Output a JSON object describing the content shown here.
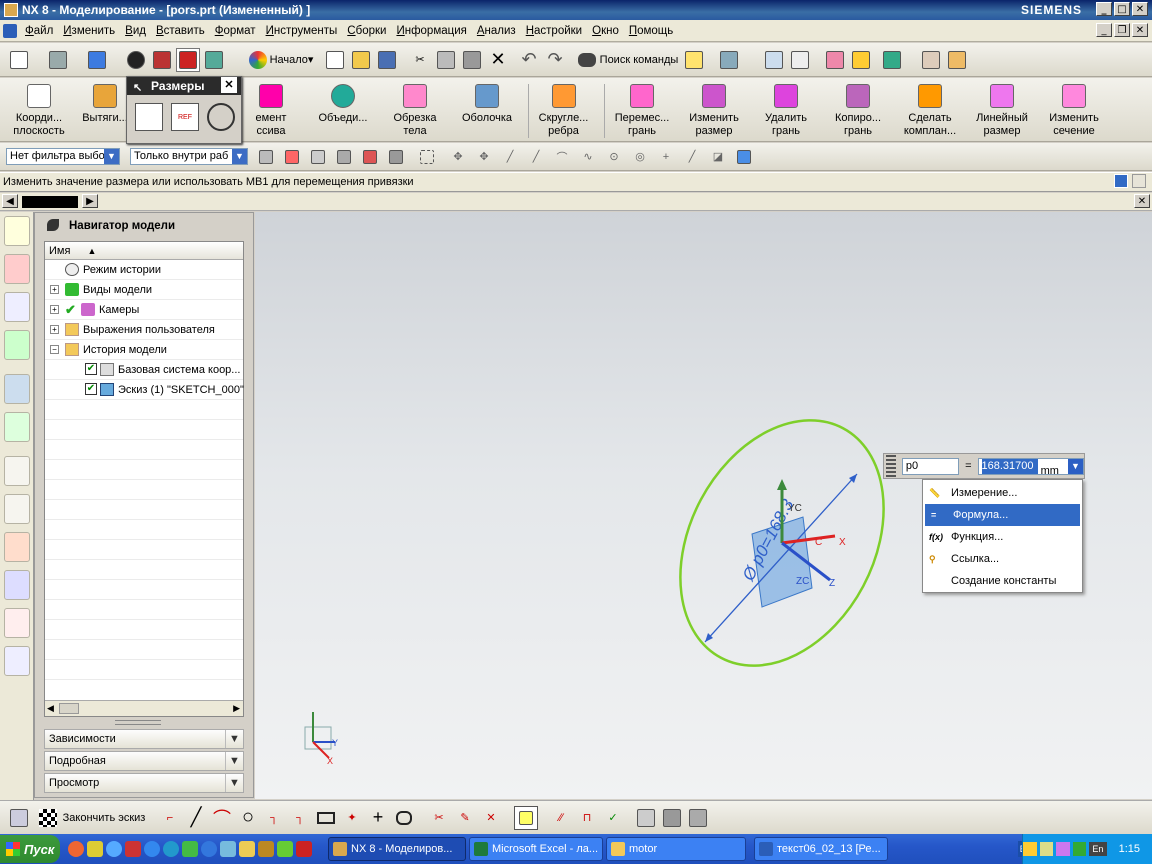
{
  "window": {
    "title": "NX 8 - Моделирование - [pors.prt (Измененный) ]",
    "brand": "SIEMENS"
  },
  "menu": [
    "Файл",
    "Изменить",
    "Вид",
    "Вставить",
    "Формат",
    "Инструменты",
    "Сборки",
    "Информация",
    "Анализ",
    "Настройки",
    "Окно",
    "Помощь"
  ],
  "toolbar1": {
    "start_label": "Начало",
    "find_command": "Поиск команды"
  },
  "dim_palette": {
    "title": "Размеры"
  },
  "toolbar2": {
    "left": [
      {
        "line1": "Коорди...",
        "line2": "плоскость"
      },
      {
        "line1": "Вытяги...",
        "line2": ""
      },
      {
        "line1": "емент",
        "line2": "ссива"
      },
      {
        "line1": "Объеди...",
        "line2": ""
      },
      {
        "line1": "Обрезка",
        "line2": "тела"
      },
      {
        "line1": "Оболочка",
        "line2": ""
      },
      {
        "line1": "Скругле...",
        "line2": "ребра"
      }
    ],
    "right": [
      {
        "line1": "Перемес...",
        "line2": "грань"
      },
      {
        "line1": "Изменить",
        "line2": "размер"
      },
      {
        "line1": "Удалить",
        "line2": "грань"
      },
      {
        "line1": "Копиро...",
        "line2": "грань"
      },
      {
        "line1": "Сделать",
        "line2": "комплан..."
      },
      {
        "line1": "Линейный",
        "line2": "размер"
      },
      {
        "line1": "Изменить",
        "line2": "сечение"
      }
    ]
  },
  "filters": {
    "type_filter": "Нет фильтра выбо",
    "scope_filter": "Только внутри раб"
  },
  "status": "Изменить значение размера или использовать МВ1 для перемещения привязки",
  "navigator": {
    "title": "Навигатор модели",
    "column": "Имя",
    "items": [
      {
        "label": "Режим истории"
      },
      {
        "label": "Виды модели"
      },
      {
        "label": "Камеры"
      },
      {
        "label": "Выражения пользователя"
      },
      {
        "label": "История модели"
      },
      {
        "label": "Базовая система коор..."
      },
      {
        "label": "Эскиз (1) \"SKETCH_000\""
      }
    ],
    "panels": [
      "Зависимости",
      "Подробная",
      "Просмотр"
    ]
  },
  "dimension_edit": {
    "name": "p0",
    "eq": "=",
    "value": "168.31700",
    "unit": "mm"
  },
  "dropdown": [
    "Измерение...",
    "Формула...",
    "Функция...",
    "Ссылка...",
    "Создание константы"
  ],
  "viewport_labels": {
    "dim_text": "Ø p0=168.3",
    "axis_x": "X",
    "axis_y": "Y",
    "axis_z": "Z",
    "yc": "YC",
    "xc": "C",
    "zc": "ZC"
  },
  "sketch_toolbar": {
    "finish": "Закончить эскиз"
  },
  "taskbar": {
    "start": "Пуск",
    "tasks": [
      "NX 8 - Моделиров...",
      "Microsoft Excel - ла...",
      "motor",
      "текст06_02_13 [Ре..."
    ],
    "lang": "EN",
    "lang2": "En",
    "time": "1:15"
  },
  "colors": {
    "accent": "#316ac5",
    "circle": "#7ecf2a",
    "sketch_plane": "#5b9be0"
  }
}
